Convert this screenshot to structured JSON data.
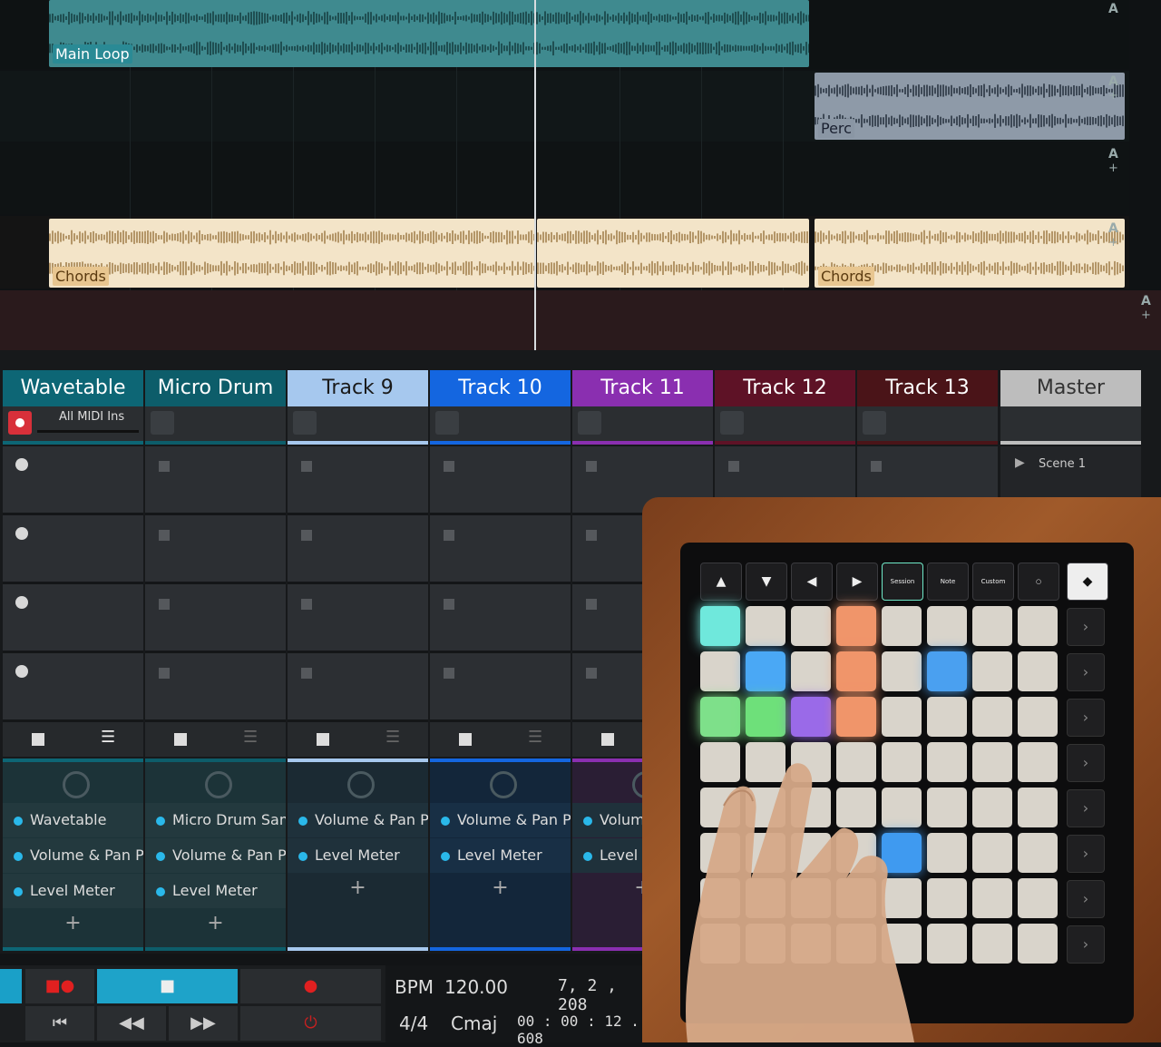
{
  "arrangement": {
    "clips": [
      {
        "label": "Main Loop",
        "color": "#2c6e72",
        "label_bg": "#2a8a95"
      },
      {
        "label": "Perc",
        "color": "#6b7682",
        "label_bg": "#8a96a4"
      },
      {
        "label": "Chords",
        "color": "#e8d6b4",
        "label_bg": "#e8c690"
      },
      {
        "label": "Chords",
        "color": "#e8d6b4",
        "label_bg": "#e8c690"
      }
    ],
    "lane_ctrl_a": "A",
    "lane_ctrl_plus": "+"
  },
  "tracks": [
    {
      "name": "Wavetable",
      "header_color": "#0d6675",
      "text_color": "#ffffff",
      "input": "All MIDI Ins",
      "fx": [
        "Wavetable",
        "Volume & Pan Plugin",
        "Level Meter"
      ]
    },
    {
      "name": "Micro Drum",
      "header_color": "#0d5d6a",
      "text_color": "#ffffff",
      "input": "",
      "fx": [
        "Micro Drum Sampler",
        "Volume & Pan Plugin",
        "Level Meter"
      ]
    },
    {
      "name": "Track 9",
      "header_color": "#a6c8ee",
      "text_color": "#1a1a1a",
      "input": "",
      "fx": [
        "Volume & Pan Plugin",
        "Level Meter"
      ]
    },
    {
      "name": "Track 10",
      "header_color": "#1466e0",
      "text_color": "#ffffff",
      "input": "",
      "fx": [
        "Volume & Pan Plugin",
        "Level Meter"
      ]
    },
    {
      "name": "Track 11",
      "header_color": "#8a2fb0",
      "text_color": "#ffffff",
      "input": "",
      "fx": [
        "Volume",
        "Level M"
      ]
    },
    {
      "name": "Track 12",
      "header_color": "#5e1226",
      "text_color": "#ffffff",
      "input": "",
      "fx": []
    },
    {
      "name": "Track 13",
      "header_color": "#4a1418",
      "text_color": "#ffffff",
      "input": "",
      "fx": []
    },
    {
      "name": "Master",
      "header_color": "#bdbdbd",
      "text_color": "#333333",
      "input": "",
      "fx": []
    }
  ],
  "scene_label": "Scene 1",
  "add_symbol": "+",
  "transport": {
    "bpm_label": "BPM",
    "bpm_value": "120.00",
    "time_sig": "4/4",
    "key": "Cmaj",
    "position": "7, 2 , 208",
    "time": "00 : 00 : 12 . 608"
  },
  "launchpad": {
    "top_buttons": [
      "▲",
      "▼",
      "◀",
      "▶",
      "Session",
      "Note",
      "Custom",
      "○"
    ],
    "pad_colors_note": "lit pads",
    "lit": {
      "0-0": "#6fe8dc",
      "0-3": "#f0956a",
      "1-1": "#4aa8f5",
      "1-3": "#f0956a",
      "1-5": "#4aa0f0",
      "2-0": "#7ee08a",
      "2-1": "#6ee07a",
      "2-2": "#9a6ae8",
      "2-3": "#f0956a",
      "5-4": "#3f9af0"
    }
  }
}
